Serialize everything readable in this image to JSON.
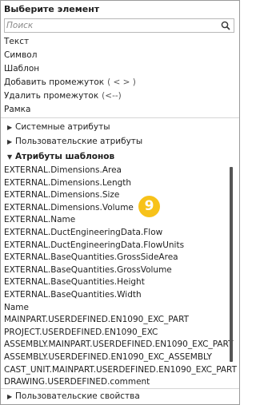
{
  "panel": {
    "title": "Выберите элемент",
    "search": {
      "placeholder": "Поиск",
      "value": "",
      "icon": "search-icon"
    }
  },
  "basic_items": [
    {
      "label": "Текст",
      "hint": ""
    },
    {
      "label": "Символ",
      "hint": ""
    },
    {
      "label": "Шаблон",
      "hint": ""
    },
    {
      "label": "Добавить промежуток",
      "hint": "( < > )"
    },
    {
      "label": "Удалить промежуток",
      "hint": "(<--)"
    },
    {
      "label": "Рамка",
      "hint": ""
    }
  ],
  "groups": {
    "system": {
      "label": "Системные атрибуты",
      "expanded": false
    },
    "user": {
      "label": "Пользовательские атрибуты",
      "expanded": false
    },
    "template": {
      "label": "Атрибуты шаблонов",
      "expanded": true
    },
    "user_properties": {
      "label": "Пользовательские свойства",
      "expanded": false
    }
  },
  "template_attributes": [
    "EXTERNAL.Dimensions.Area",
    "EXTERNAL.Dimensions.Length",
    "EXTERNAL.Dimensions.Size",
    "EXTERNAL.Dimensions.Volume",
    "EXTERNAL.Name",
    "EXTERNAL.DuctEngineeringData.Flow",
    "EXTERNAL.DuctEngineeringData.FlowUnits",
    "EXTERNAL.BaseQuantities.GrossSideArea",
    "EXTERNAL.BaseQuantities.GrossVolume",
    "EXTERNAL.BaseQuantities.Height",
    "EXTERNAL.BaseQuantities.Width",
    "Name",
    "MAINPART.USERDEFINED.EN1090_EXC_PART",
    "PROJECT.USERDEFINED.EN1090_EXC",
    "ASSEMBLY.MAINPART.USERDEFINED.EN1090_EXC_PART",
    "ASSEMBLY.USERDEFINED.EN1090_EXC_ASSEMBLY",
    "CAST_UNIT.MAINPART.USERDEFINED.EN1090_EXC_PART",
    "DRAWING.USERDEFINED.comment"
  ],
  "callout": {
    "number": "9",
    "color": "#f7c21a"
  },
  "colors": {
    "border": "#9a9a9a",
    "separator": "#d6d6d6",
    "scroll_thumb": "#555555"
  }
}
